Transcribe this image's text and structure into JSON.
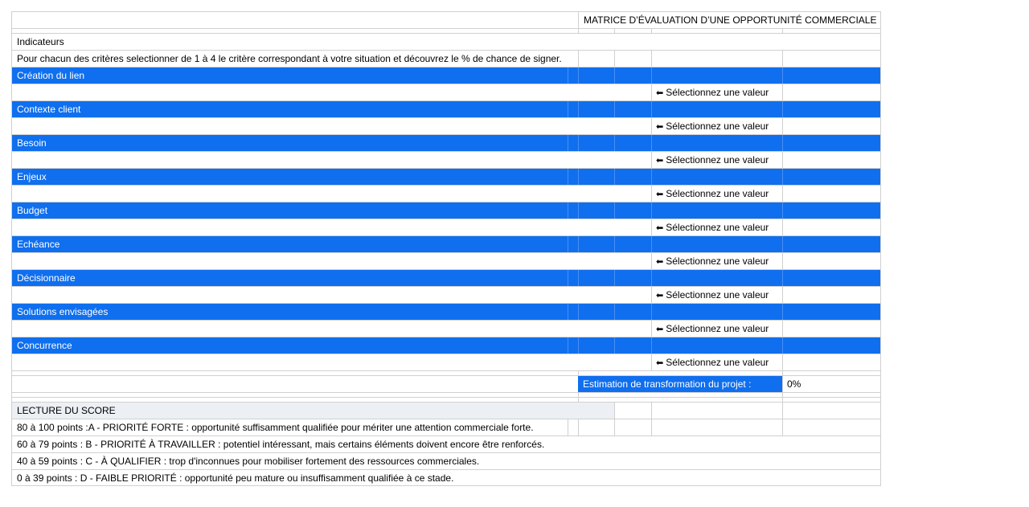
{
  "title": "MATRICE D’ÉVALUATION D’UNE OPPORTUNITÉ COMMERCIALE",
  "indicators_label": "Indicateurs",
  "instructions": "Pour chacun des critères selectionner de 1 à 4 le critère correspondant à votre situation et découvrez le % de chance de signer.",
  "criteria": [
    {
      "label": "Création du lien",
      "select": "Sélectionnez une valeur"
    },
    {
      "label": "Contexte client",
      "select": "Sélectionnez une valeur"
    },
    {
      "label": "Besoin",
      "select": "Sélectionnez une valeur"
    },
    {
      "label": "Enjeux",
      "select": "Sélectionnez une valeur"
    },
    {
      "label": "Budget",
      "select": "Sélectionnez une valeur"
    },
    {
      "label": "Echéance",
      "select": "Sélectionnez une valeur"
    },
    {
      "label": "Décisionnaire",
      "select": "Sélectionnez une valeur"
    },
    {
      "label": "Solutions envisagées",
      "select": "Sélectionnez une valeur"
    },
    {
      "label": "Concurrence",
      "select": "Sélectionnez une valeur"
    }
  ],
  "estimation": {
    "label": "Estimation de transformation du projet :",
    "value": "0%"
  },
  "lecture": {
    "title": "LECTURE DU SCORE",
    "lines": [
      "80 à 100 points :A - PRIORITÉ FORTE : opportunité suffisamment qualifiée pour mériter une attention commerciale forte.",
      "60 à 79 points : B - PRIORITÉ À TRAVAILLER : potentiel intéressant, mais certains éléments doivent encore être renforcés.",
      "40 à 59 points : C - À QUALIFIER : trop d'inconnues pour mobiliser fortement des ressources commerciales.",
      "0 à 39 points : D - FAIBLE PRIORITÉ : opportunité peu mature ou insuffisamment qualifiée à ce stade."
    ]
  },
  "icons": {
    "select_arrow": "left-arrow-icon"
  },
  "colors": {
    "section_blue": "#0f6fee",
    "grid": "#d0d0d0",
    "lecture_bg": "#eceff3"
  }
}
